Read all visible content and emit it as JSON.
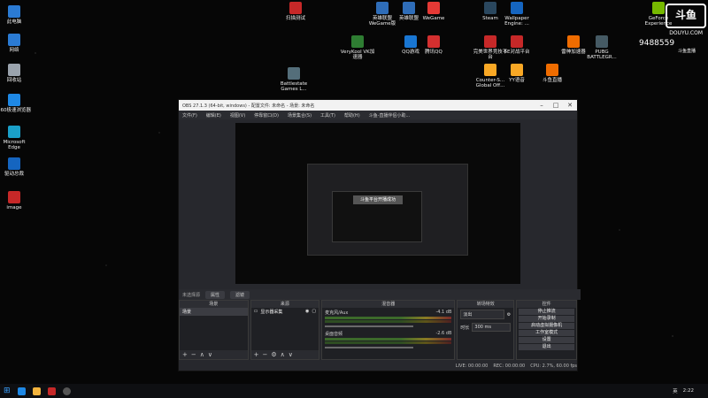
{
  "desktop": {
    "icons_left": [
      {
        "label": "此电脑",
        "color": "#2b7bd4"
      },
      {
        "label": "网络",
        "color": "#2b7bd4"
      },
      {
        "label": "回收站",
        "color": "#9aa3ad"
      },
      {
        "label": "360极速浏览器",
        "color": "#1e88e5"
      },
      {
        "label": "Microsoft Edge",
        "color": "#1aa0c9"
      },
      {
        "label": "驱动总裁",
        "color": "#1565c0"
      },
      {
        "label": "image",
        "color": "#c62828"
      }
    ],
    "icons_top": [
      {
        "label": "扫描测试",
        "color": "#c62828"
      },
      {
        "label": "英雄联盟 WeGame版",
        "color": "#2f6db8"
      },
      {
        "label": "英雄联盟",
        "color": "#2f6db8"
      },
      {
        "label": "WeGame",
        "color": "#e53935"
      },
      {
        "label": "VeryKool VK加速器",
        "color": "#2e7d32"
      },
      {
        "label": "QQ游戏",
        "color": "#1976d2"
      },
      {
        "label": "腾讯QQ",
        "color": "#d32f2f"
      },
      {
        "label": "Battlestate Games L...",
        "color": "#546e7a"
      },
      {
        "label": "Steam",
        "color": "#2a475e"
      },
      {
        "label": "Wallpaper Engine: ...",
        "color": "#1565c0"
      },
      {
        "label": "完美世界竞技平台",
        "color": "#c62828"
      },
      {
        "label": "5E对战平台",
        "color": "#c62828"
      },
      {
        "label": "雷神加速器",
        "color": "#ef6c00"
      },
      {
        "label": "PUBG BATTLEGR...",
        "color": "#455a64"
      },
      {
        "label": "Counter-S... Global Off...",
        "color": "#f9a825"
      },
      {
        "label": "YY语音",
        "color": "#f9a825"
      },
      {
        "label": "斗鱼直播",
        "color": "#ef6c00"
      },
      {
        "label": "GeForce Experience",
        "color": "#76b900"
      }
    ]
  },
  "watermark": {
    "logo": "斗鱼",
    "site": "DOUYU.COM",
    "room_id": "9488559",
    "sub": "斗鱼直播"
  },
  "obs": {
    "title": "OBS 27.1.3 (64-bit, windows) - 配置文件: 未命名 - 场景: 未命名",
    "menu": [
      "文件(F)",
      "编辑(E)",
      "视图(V)",
      "停靠窗口(D)",
      "场景集合(S)",
      "工具(T)",
      "帮助(H)",
      "斗鱼-直播伴侣小助..."
    ],
    "toast": "斗鱼平台开播成功",
    "scene_info": {
      "label": "未选择源",
      "props": "属性",
      "filters": "滤镜"
    },
    "docks": {
      "scenes": {
        "header": "场景",
        "item": "场景"
      },
      "sources": {
        "header": "来源",
        "item": "显示器采集"
      },
      "mixer": {
        "header": "混音器",
        "channels": [
          {
            "name": "麦克风/Aux",
            "db": "-4.1 dB"
          },
          {
            "name": "桌面音频",
            "db": "-2.6 dB"
          }
        ]
      },
      "transitions": {
        "header": "转场特效",
        "type": "淡出",
        "duration_label": "时长",
        "duration": "300 ms"
      },
      "controls": {
        "header": "控件",
        "buttons": [
          "停止推流",
          "开始录制",
          "启动虚拟摄像机",
          "工作室模式",
          "设置",
          "退出"
        ]
      }
    },
    "status": {
      "live": "LIVE: 00:00:00",
      "rec": "REC: 00:00:00",
      "cpu": "CPU: 2.7%, 60.00 fps"
    }
  },
  "taskbar": {
    "time": "2:22",
    "lang": "英"
  }
}
